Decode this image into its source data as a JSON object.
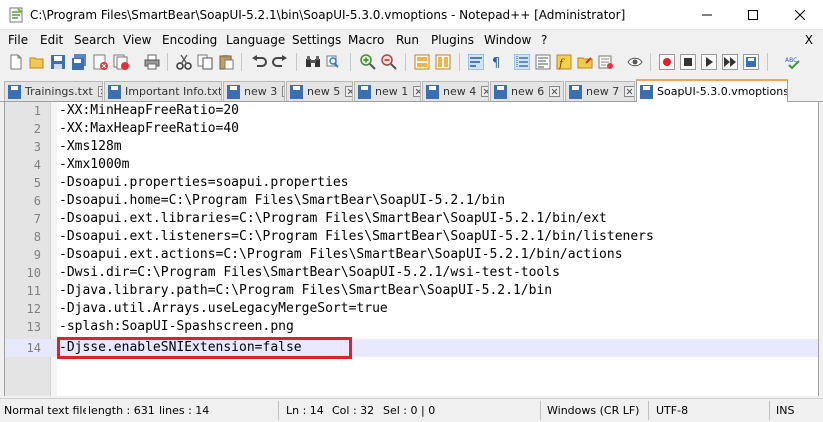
{
  "window": {
    "title": "C:\\Program Files\\SmartBear\\SoapUI-5.2.1\\bin\\SoapUI-5.3.0.vmoptions - Notepad++ [Administrator]"
  },
  "menu": {
    "items": [
      "File",
      "Edit",
      "Search",
      "View",
      "Encoding",
      "Language",
      "Settings",
      "Macro",
      "Run",
      "Plugins",
      "Window",
      "?"
    ],
    "close_label": "X"
  },
  "toolbar": {
    "icons": [
      "new-file",
      "open-file",
      "save",
      "save-all",
      "close",
      "close-all",
      "print",
      "cut",
      "copy",
      "paste",
      "undo",
      "redo",
      "find",
      "replace",
      "zoom-in",
      "zoom-out",
      "sync-vertical",
      "sync-horizontal",
      "word-wrap",
      "show-all-chars",
      "indent-guide",
      "doc-map",
      "function-list",
      "folder-as-workspace",
      "monitoring",
      "record-macro",
      "stop-record",
      "play-macro",
      "play-multiple",
      "save-macro",
      "spell-check"
    ]
  },
  "tabs": [
    {
      "label": "Trainings.txt",
      "active": false
    },
    {
      "label": "Important Info.txt",
      "active": false
    },
    {
      "label": "new 3",
      "active": false
    },
    {
      "label": "new 5",
      "active": false
    },
    {
      "label": "new 1",
      "active": false
    },
    {
      "label": "new 4",
      "active": false
    },
    {
      "label": "new 6",
      "active": false
    },
    {
      "label": "new 7",
      "active": false
    },
    {
      "label": "SoapUI-5.3.0.vmoptions",
      "active": true
    }
  ],
  "editor": {
    "lines": [
      {
        "n": "1",
        "text": "-XX:MinHeapFreeRatio=20"
      },
      {
        "n": "2",
        "text": "-XX:MaxHeapFreeRatio=40"
      },
      {
        "n": "3",
        "text": "-Xms128m"
      },
      {
        "n": "4",
        "text": "-Xmx1000m"
      },
      {
        "n": "5",
        "text": "-Dsoapui.properties=soapui.properties"
      },
      {
        "n": "6",
        "text": "-Dsoapui.home=C:\\Program Files\\SmartBear\\SoapUI-5.2.1/bin"
      },
      {
        "n": "7",
        "text": "-Dsoapui.ext.libraries=C:\\Program Files\\SmartBear\\SoapUI-5.2.1/bin/ext"
      },
      {
        "n": "8",
        "text": "-Dsoapui.ext.listeners=C:\\Program Files\\SmartBear\\SoapUI-5.2.1/bin/listeners"
      },
      {
        "n": "9",
        "text": "-Dsoapui.ext.actions=C:\\Program Files\\SmartBear\\SoapUI-5.2.1/bin/actions"
      },
      {
        "n": "10",
        "text": "-Dwsi.dir=C:\\Program Files\\SmartBear\\SoapUI-5.2.1/wsi-test-tools"
      },
      {
        "n": "11",
        "text": "-Djava.library.path=C:\\Program Files\\SmartBear\\SoapUI-5.2.1/bin"
      },
      {
        "n": "12",
        "text": "-Djava.util.Arrays.useLegacyMergeSort=true"
      },
      {
        "n": "13",
        "text": "-splash:SoapUI-Spashscreen.png"
      },
      {
        "n": "14",
        "text": "-Djsse.enableSNIExtension=false"
      }
    ],
    "current_line": "14",
    "highlight_color": "#d9252a"
  },
  "status": {
    "file_type": "Normal text file",
    "length": "length : 631",
    "lines": "lines : 14",
    "ln": "Ln : 14",
    "col": "Col : 32",
    "sel": "Sel : 0 | 0",
    "eol": "Windows (CR LF)",
    "encoding": "UTF-8",
    "mode": "INS"
  }
}
